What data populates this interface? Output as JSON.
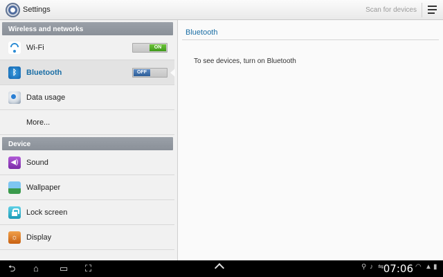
{
  "actionbar": {
    "title": "Settings",
    "scan_label": "Scan for devices",
    "menu_icon": "overflow-menu-icon"
  },
  "sidebar": {
    "sections": [
      {
        "header": "Wireless and networks",
        "items": [
          {
            "label": "Wi-Fi",
            "icon": "wifi-icon",
            "toggle": "ON"
          },
          {
            "label": "Bluetooth",
            "icon": "bluetooth-icon",
            "toggle": "OFF",
            "selected": true
          },
          {
            "label": "Data usage",
            "icon": "data-usage-icon"
          },
          {
            "label": "More..."
          }
        ]
      },
      {
        "header": "Device",
        "items": [
          {
            "label": "Sound",
            "icon": "sound-icon"
          },
          {
            "label": "Wallpaper",
            "icon": "wallpaper-icon"
          },
          {
            "label": "Lock screen",
            "icon": "lock-icon"
          },
          {
            "label": "Display",
            "icon": "display-icon"
          }
        ]
      }
    ]
  },
  "detail": {
    "title": "Bluetooth",
    "hint": "To see devices, turn on Bluetooth"
  },
  "navbar": {
    "time": "07:06"
  },
  "colors": {
    "accent": "#1a6ea5",
    "toggle_on": "#3f9a1b",
    "toggle_off": "#2c5d97"
  }
}
